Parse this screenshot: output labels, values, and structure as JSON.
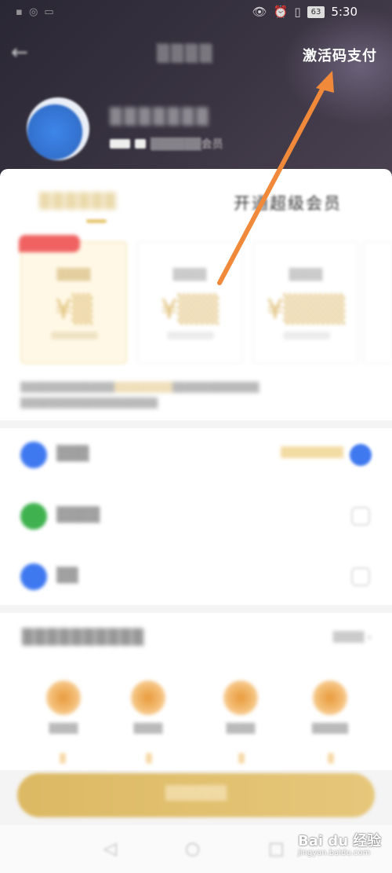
{
  "status_bar": {
    "battery": "63",
    "time": "5:30"
  },
  "header": {
    "activate_code_pay": "激活码支付",
    "vip_suffix": "会员"
  },
  "tabs": {
    "super_vip": "开通超级会员"
  },
  "watermark": {
    "brand": "Bai du 经验",
    "url": "jingyan.baidu.com"
  },
  "colors": {
    "accent_gold": "#e0c07a",
    "arrow": "#f08a3a",
    "header_bg": "#2f2b38",
    "alipay_blue": "#3f79f0",
    "wechat_green": "#3fb24f"
  },
  "icons": {
    "back": "arrow-left-icon",
    "eye": "eye-icon",
    "alarm": "alarm-icon",
    "vibrate": "vibrate-icon",
    "battery": "battery-icon"
  }
}
